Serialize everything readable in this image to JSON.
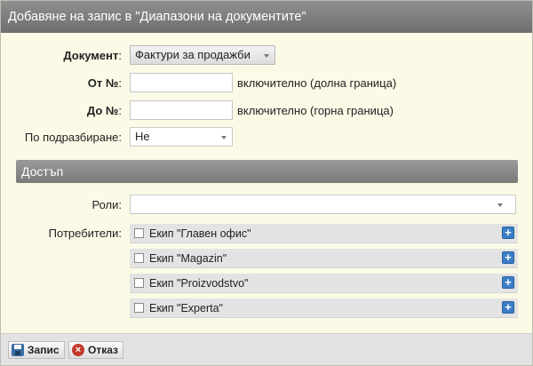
{
  "window": {
    "title": "Добавяне на запис в \"Диапазони на документите\""
  },
  "form": {
    "document": {
      "label": "Документ",
      "value": "Фактури за продажби"
    },
    "from": {
      "label": "От №",
      "value": "",
      "hint": "включително (долна граница)"
    },
    "to": {
      "label": "До №",
      "value": "",
      "hint": "включително (горна граница)"
    },
    "default": {
      "label": "По подразбиране",
      "value": "Не"
    },
    "colon": ":"
  },
  "access": {
    "title": "Достъп",
    "roles": {
      "label": "Роли",
      "value": ""
    },
    "users": {
      "label": "Потребители",
      "items": [
        {
          "label": "Екип \"Главен офис\"",
          "checked": false
        },
        {
          "label": "Екип \"Magazin\"",
          "checked": false
        },
        {
          "label": "Екип \"Proizvodstvo\"",
          "checked": false
        },
        {
          "label": "Екип \"Experta\"",
          "checked": false
        }
      ]
    }
  },
  "footer": {
    "save_label": "Запис",
    "cancel_label": "Отказ"
  }
}
